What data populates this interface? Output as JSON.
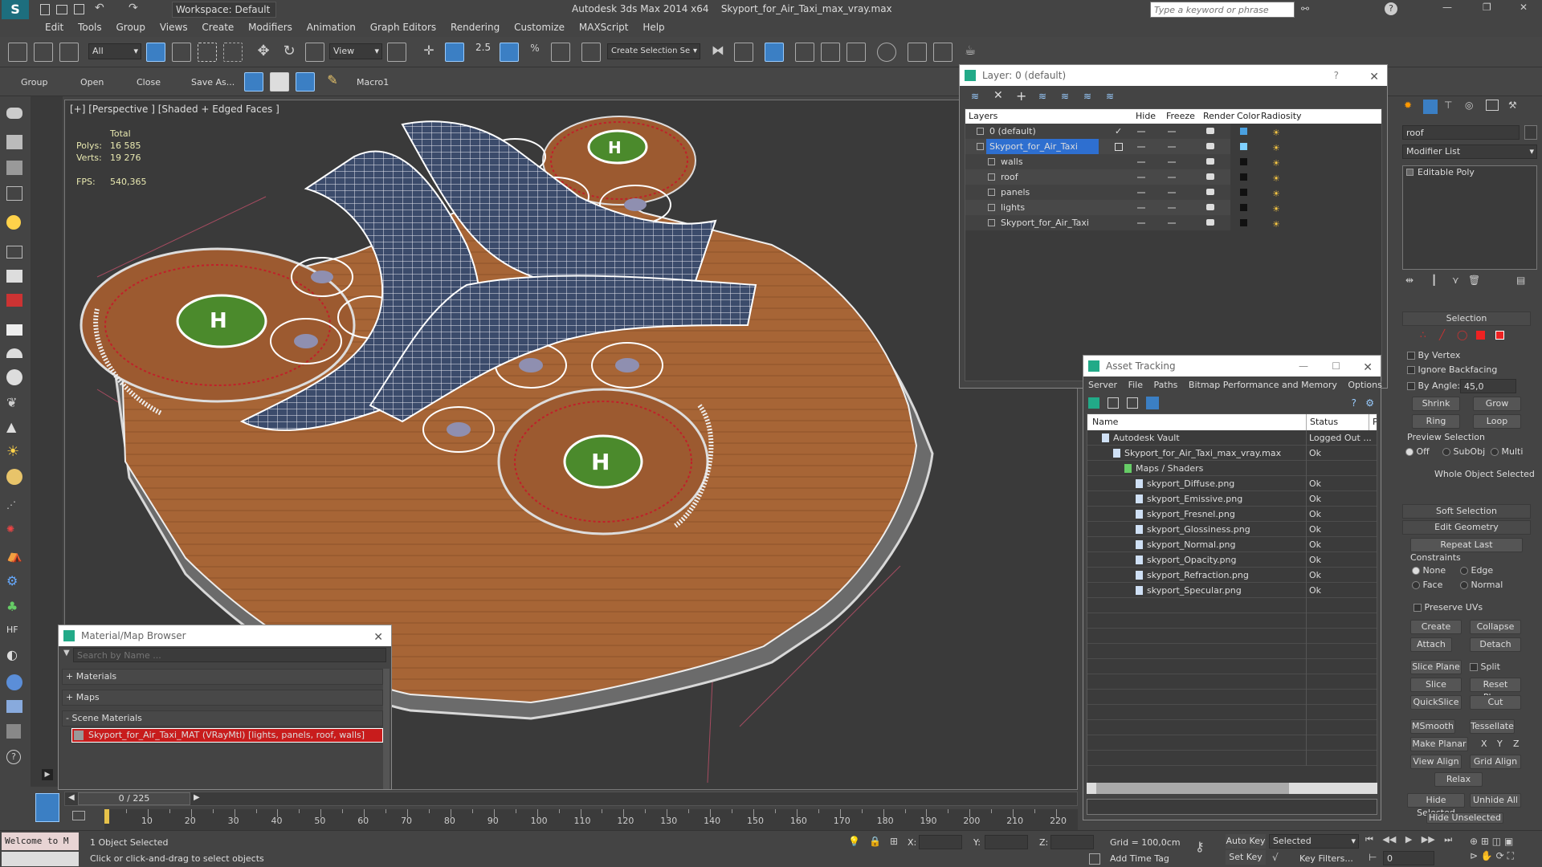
{
  "title_bar": {
    "workspace": "Workspace: Default",
    "app": "Autodesk 3ds Max  2014 x64",
    "file": "Skyport_for_Air_Taxi_max_vray.max",
    "search_placeholder": "Type a keyword or phrase"
  },
  "menu": [
    "Edit",
    "Tools",
    "Group",
    "Views",
    "Create",
    "Modifiers",
    "Animation",
    "Graph Editors",
    "Rendering",
    "Customize",
    "MAXScript",
    "Help"
  ],
  "main_toolbar": {
    "filter": "All",
    "ref_coord": "View",
    "snap_value": "2.5",
    "selection_set": "Create Selection Se"
  },
  "toolbar2": {
    "group": "Group",
    "open": "Open",
    "close": "Close",
    "save_as": "Save As...",
    "macro": "Macro1"
  },
  "viewport": {
    "label": "[+] [Perspective ] [Shaded + Edged Faces ]",
    "stats_total": "Total",
    "polys_label": "Polys:",
    "polys_value": "16 585",
    "verts_label": "Verts:",
    "verts_value": "19 276",
    "fps_label": "FPS:",
    "fps_value": "540,365"
  },
  "layer_window": {
    "title": "Layer: 0 (default)",
    "help": "?",
    "columns": [
      "Layers",
      "Hide",
      "Freeze",
      "Render",
      "Color",
      "Radiosity"
    ],
    "rows": [
      {
        "name": "0 (default)",
        "indent": 0,
        "selected": false,
        "color": "#4aa0e0"
      },
      {
        "name": "Skyport_for_Air_Taxi",
        "indent": 0,
        "selected": true,
        "color": "#7fd0ff"
      },
      {
        "name": "walls",
        "indent": 1,
        "selected": false,
        "color": "#111111"
      },
      {
        "name": "roof",
        "indent": 1,
        "selected": false,
        "color": "#111111"
      },
      {
        "name": "panels",
        "indent": 1,
        "selected": false,
        "color": "#111111"
      },
      {
        "name": "lights",
        "indent": 1,
        "selected": false,
        "color": "#111111"
      },
      {
        "name": "Skyport_for_Air_Taxi",
        "indent": 1,
        "selected": false,
        "color": "#111111"
      }
    ]
  },
  "asset_window": {
    "title": "Asset Tracking",
    "menu": [
      "Server",
      "File",
      "Paths",
      "Bitmap Performance and Memory",
      "Options"
    ],
    "columns": [
      "Name",
      "Status",
      "P"
    ],
    "rows": [
      {
        "name": "Autodesk Vault",
        "status": "Logged Out ...",
        "indent": 1
      },
      {
        "name": "Skyport_for_Air_Taxi_max_vray.max",
        "status": "Ok",
        "indent": 2
      },
      {
        "name": "Maps / Shaders",
        "status": "",
        "indent": 3
      },
      {
        "name": "skyport_Diffuse.png",
        "status": "Ok",
        "indent": 4
      },
      {
        "name": "skyport_Emissive.png",
        "status": "Ok",
        "indent": 4
      },
      {
        "name": "skyport_Fresnel.png",
        "status": "Ok",
        "indent": 4
      },
      {
        "name": "skyport_Glossiness.png",
        "status": "Ok",
        "indent": 4
      },
      {
        "name": "skyport_Normal.png",
        "status": "Ok",
        "indent": 4
      },
      {
        "name": "skyport_Opacity.png",
        "status": "Ok",
        "indent": 4
      },
      {
        "name": "skyport_Refraction.png",
        "status": "Ok",
        "indent": 4
      },
      {
        "name": "skyport_Specular.png",
        "status": "Ok",
        "indent": 4
      }
    ]
  },
  "material_browser": {
    "title": "Material/Map Browser",
    "search_placeholder": "Search by Name ...",
    "sections": [
      "+ Materials",
      "+ Maps",
      "- Scene Materials"
    ],
    "scene_material": "Skyport_for_Air_Taxi_MAT (VRayMtl) [lights, panels, roof, walls]"
  },
  "command_panel": {
    "object_name": "roof",
    "modifier_list": "Modifier List",
    "stack_item": "Editable Poly",
    "selection_title": "Selection",
    "by_vertex": "By Vertex",
    "ignore_backfacing": "Ignore Backfacing",
    "by_angle": "By Angle:",
    "angle_value": "45,0",
    "shrink": "Shrink",
    "grow": "Grow",
    "ring": "Ring",
    "loop": "Loop",
    "preview_selection": "Preview Selection",
    "off": "Off",
    "subobj": "SubObj",
    "multi": "Multi",
    "whole_object": "Whole Object Selected",
    "soft_selection": "Soft Selection",
    "edit_geometry": "Edit Geometry",
    "repeat_last": "Repeat Last",
    "constraints": "Constraints",
    "none": "None",
    "edge": "Edge",
    "face": "Face",
    "normal": "Normal",
    "preserve_uvs": "Preserve UVs",
    "create": "Create",
    "collapse": "Collapse",
    "attach": "Attach",
    "detach": "Detach",
    "slice_plane": "Slice Plane",
    "split": "Split",
    "slice": "Slice",
    "reset_plane": "Reset Plane",
    "quickslice": "QuickSlice",
    "cut": "Cut",
    "msmooth": "MSmooth",
    "tessellate": "Tessellate",
    "make_planar": "Make Planar",
    "x": "X",
    "y": "Y",
    "z": "Z",
    "view_align": "View Align",
    "grid_align": "Grid Align",
    "relax": "Relax",
    "hide_selected": "Hide Selected",
    "unhide_all": "Unhide All",
    "hide_unselected": "Hide Unselected"
  },
  "timeline": {
    "frame": "0 / 225",
    "ticks": [
      "10",
      "20",
      "30",
      "40",
      "50",
      "60",
      "70",
      "80",
      "90",
      "100",
      "110",
      "120",
      "130",
      "140",
      "150",
      "160",
      "170",
      "180",
      "190",
      "200",
      "210",
      "220"
    ]
  },
  "status": {
    "welcome": "Welcome to M",
    "selected": "1 Object Selected",
    "prompt": "Click or click-and-drag to select objects",
    "x_label": "X:",
    "y_label": "Y:",
    "z_label": "Z:",
    "grid": "Grid = 100,0cm",
    "add_time_tag": "Add Time Tag",
    "auto_key": "Auto Key",
    "set_key": "Set Key",
    "selected_dropdown": "Selected",
    "key_filters": "Key Filters...",
    "frame_field": "0"
  }
}
